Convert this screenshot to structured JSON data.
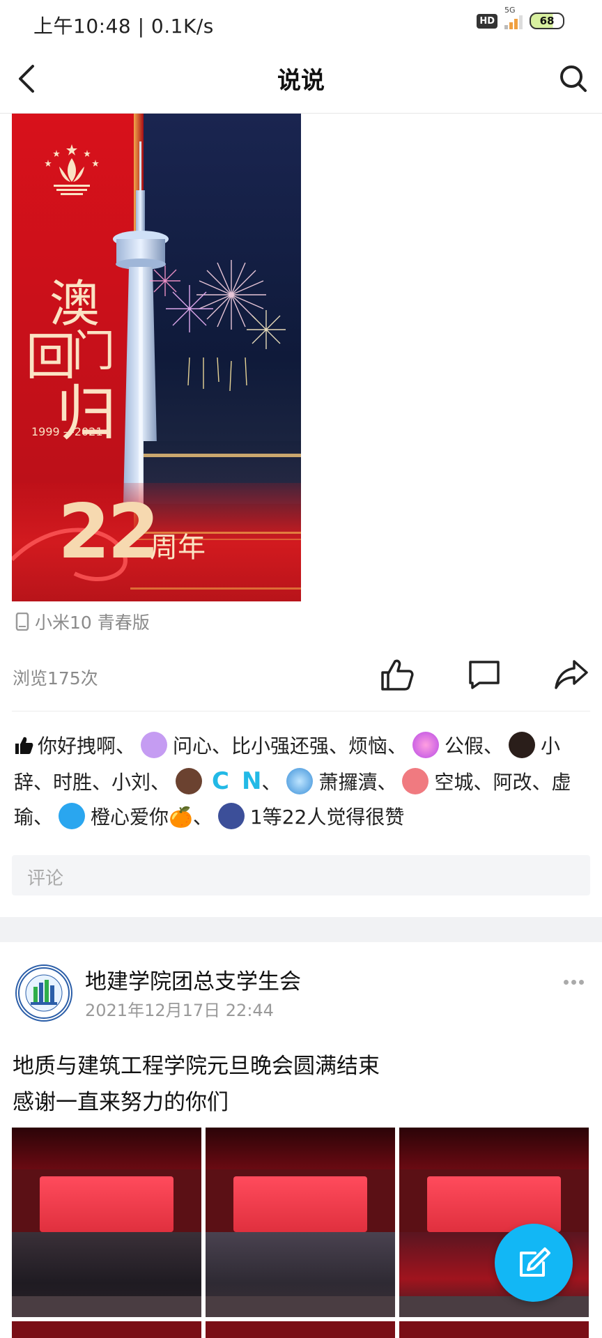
{
  "status_bar": {
    "time": "上午10:48 | 0.1K/s",
    "network_label": "5G",
    "hd_label": "HD",
    "battery": "68"
  },
  "header": {
    "title": "说说"
  },
  "post1": {
    "poster_text": {
      "char1": "澳",
      "char2": "回",
      "char3": "门",
      "char4": "归",
      "years": "1999 —2021",
      "number": "22",
      "suffix": "周年"
    },
    "device": "小米10 青春版",
    "views": "浏览175次",
    "likes": {
      "seg1": "你好拽啊、",
      "seg2": "问心、比小强还强、烦恼、",
      "seg3": "公假、",
      "seg4": "小辞、时胜、小刘、",
      "seg5": "C",
      "seg6": "N",
      "seg7": "、",
      "seg8": "萧攞瀆、",
      "seg9": "空城、阿改、虚瑜、",
      "seg10": "橙心爱你🍊、",
      "seg11": "1等22人觉得很赞"
    },
    "comment_placeholder": "评论"
  },
  "post2": {
    "author": "地建学院团总支学生会",
    "date": "2021年12月17日 22:44",
    "line1": "地质与建筑工程学院元旦晚会圆满结束",
    "line2": "感谢一直来努力的你们"
  },
  "colors": {
    "accent": "#12b7f5",
    "poster_red": "#d8111b"
  }
}
